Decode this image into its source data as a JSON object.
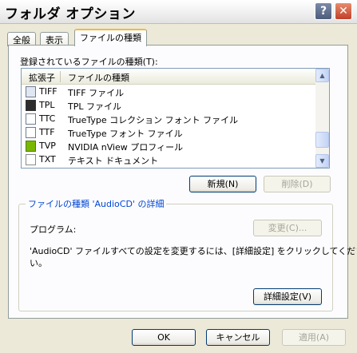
{
  "window": {
    "title": "フォルダ オプション",
    "help_glyph": "?",
    "close_glyph": "✕"
  },
  "tabs": [
    {
      "label": "全般"
    },
    {
      "label": "表示"
    },
    {
      "label": "ファイルの種類"
    }
  ],
  "file_types": {
    "label": "登録されているファイルの種類(T):",
    "columns": [
      "拡張子",
      "ファイルの種類"
    ],
    "rows": [
      {
        "ext": "TIFF",
        "type": "TIFF ファイル",
        "icon": "image-file-icon"
      },
      {
        "ext": "TPL",
        "type": "TPL ファイル",
        "icon": "movie-file-icon"
      },
      {
        "ext": "TTC",
        "type": "TrueType コレクション フォント ファイル",
        "icon": "font-file-icon"
      },
      {
        "ext": "TTF",
        "type": "TrueType フォント ファイル",
        "icon": "font-file-icon"
      },
      {
        "ext": "TVP",
        "type": "NVIDIA nView プロフィール",
        "icon": "nvidia-file-icon"
      },
      {
        "ext": "TXT",
        "type": "テキスト ドキュメント",
        "icon": "text-file-icon"
      }
    ],
    "scroll_up": "▲",
    "scroll_down": "▼"
  },
  "buttons": {
    "new": "新規(N)",
    "delete": "削除(D)",
    "change": "変更(C)...",
    "advanced": "詳細設定(V)",
    "ok": "OK",
    "cancel": "キャンセル",
    "apply": "適用(A)"
  },
  "details": {
    "group_title": "ファイルの種類 'AudioCD' の詳細",
    "program_label": "プログラム:",
    "description_line1": "'AudioCD' ファイルすべての設定を変更するには、[詳細設定] をクリックしてくださ",
    "description_line2": "い。"
  }
}
